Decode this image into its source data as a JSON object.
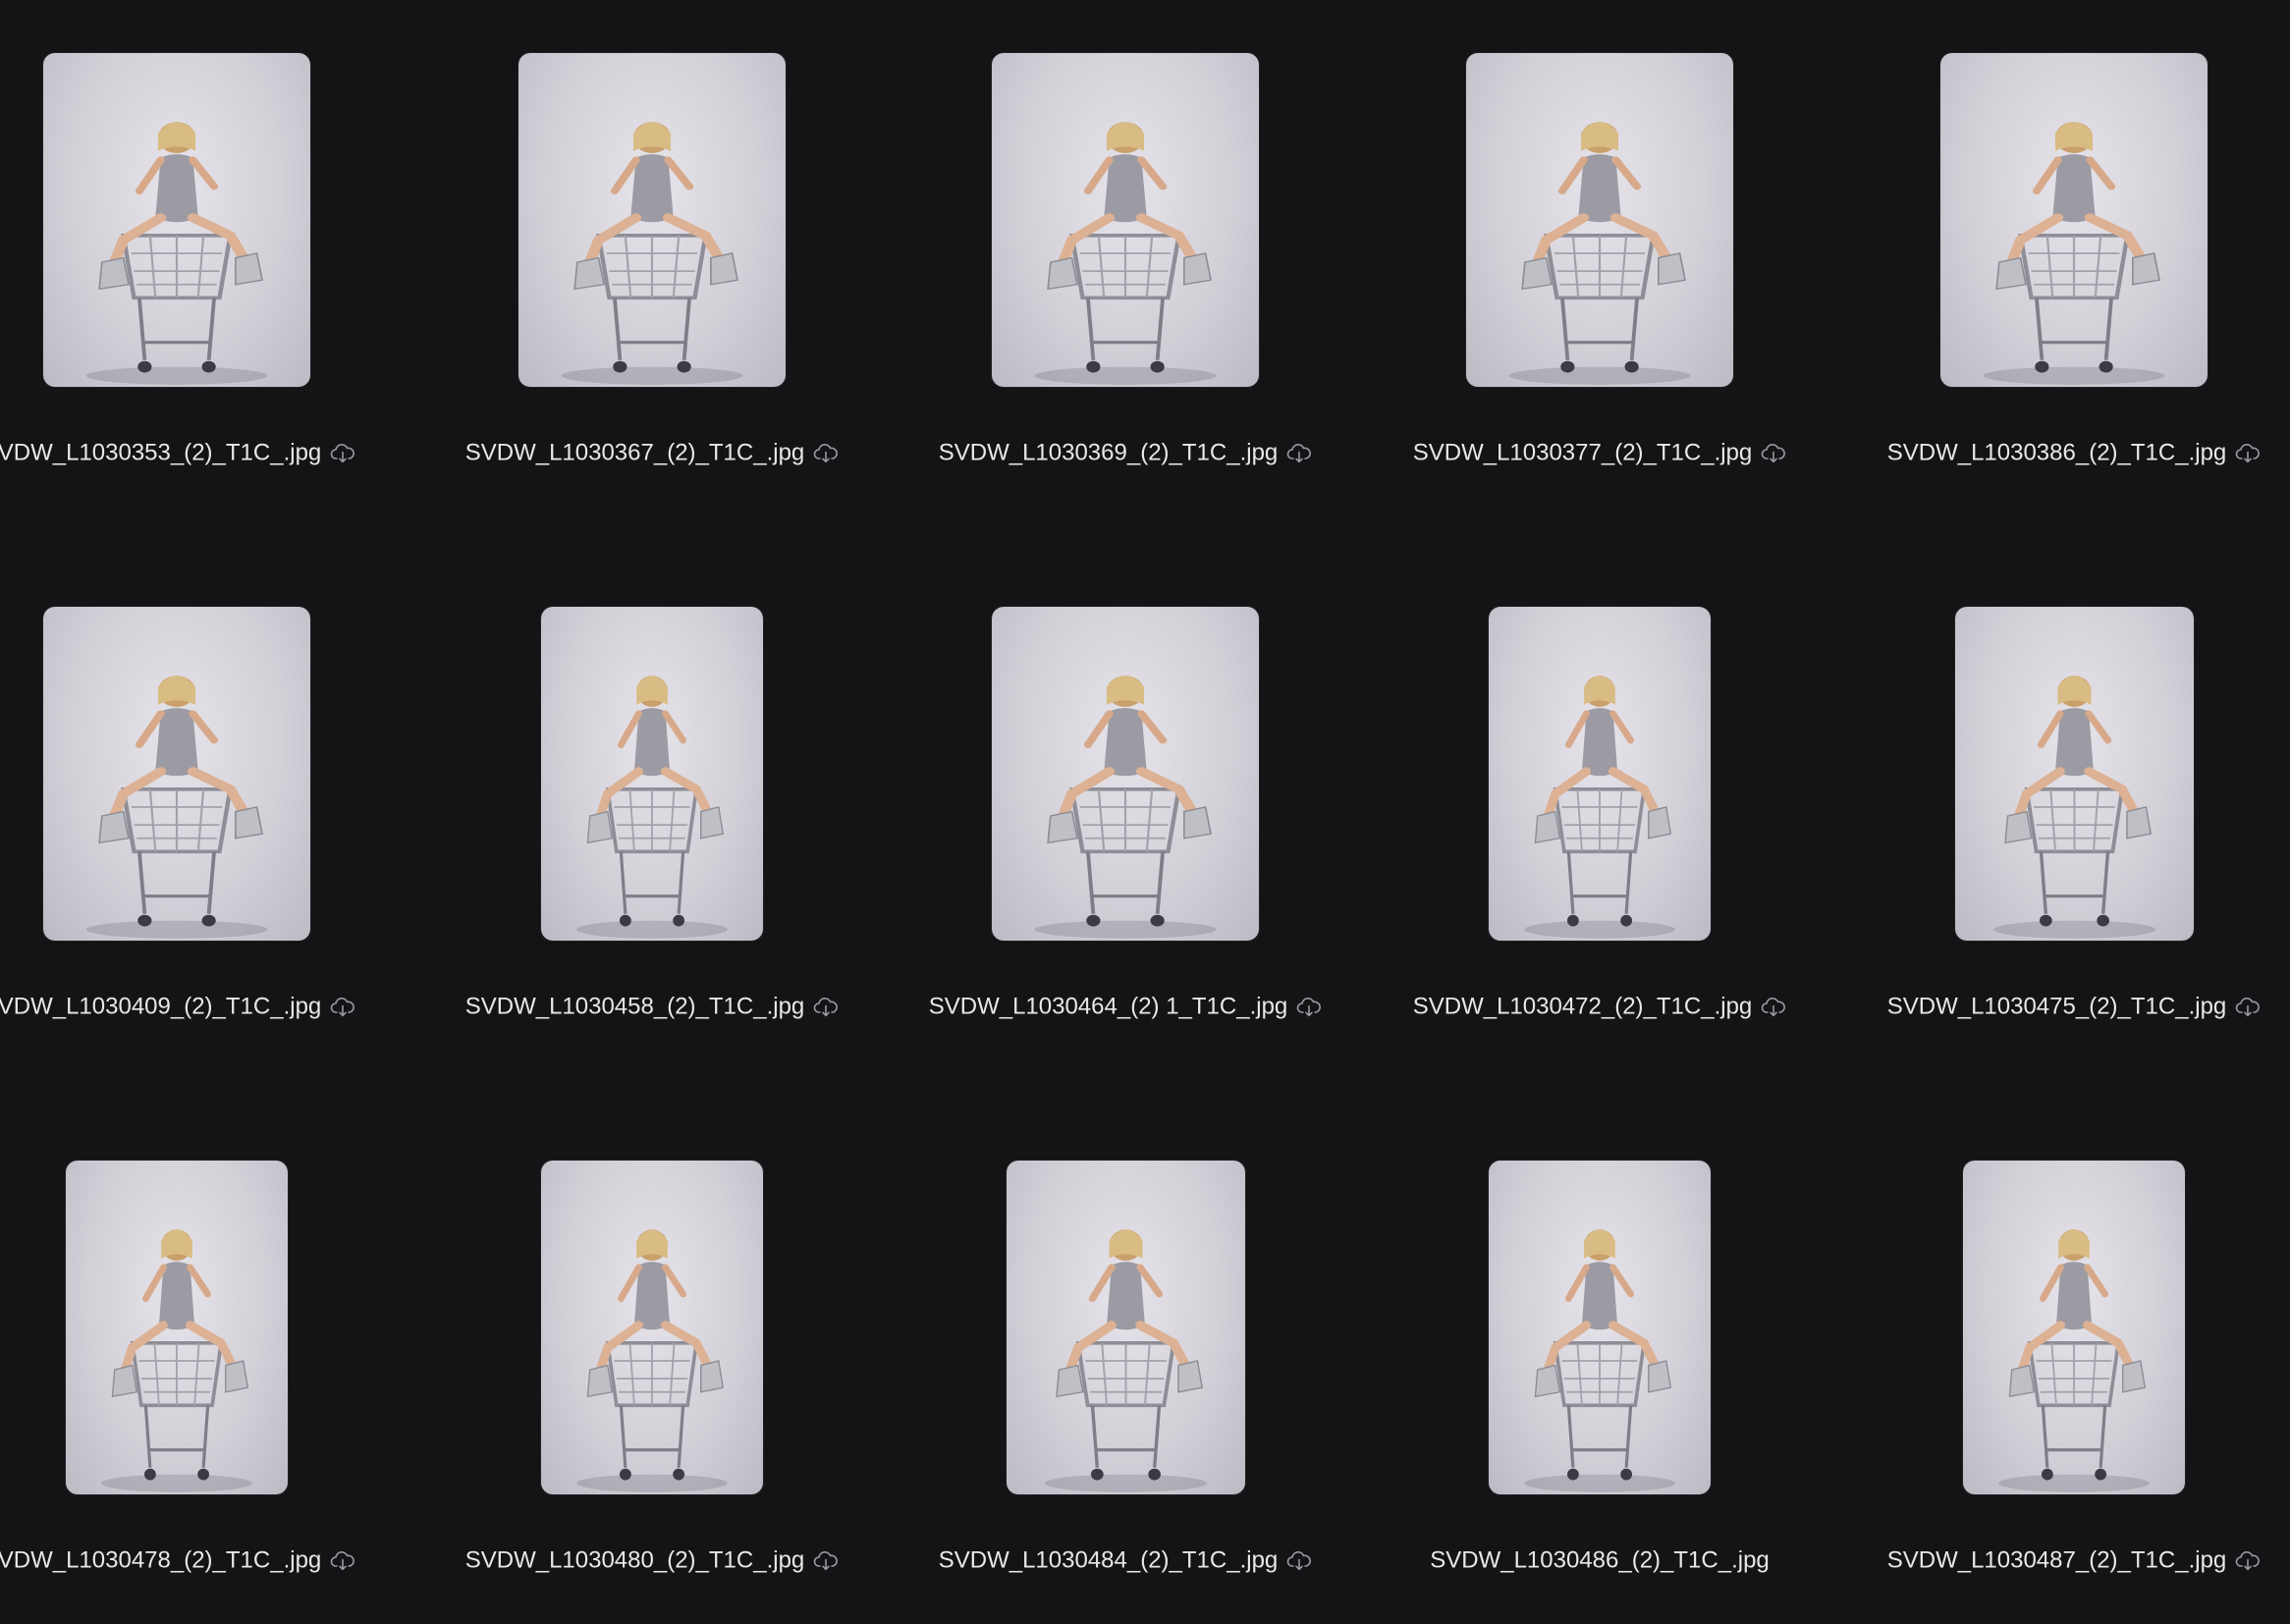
{
  "files": [
    {
      "name": "VDW_L1030353_(2)_T1C_.jpg",
      "cloud": true,
      "thumb": "landscape-wide"
    },
    {
      "name": "SVDW_L1030367_(2)_T1C_.jpg",
      "cloud": true,
      "thumb": "landscape-wide"
    },
    {
      "name": "SVDW_L1030369_(2)_T1C_.jpg",
      "cloud": true,
      "thumb": "landscape-wide"
    },
    {
      "name": "SVDW_L1030377_(2)_T1C_.jpg",
      "cloud": true,
      "thumb": "landscape-wide"
    },
    {
      "name": "SVDW_L1030386_(2)_T1C_.jpg",
      "cloud": true,
      "thumb": "landscape-wide"
    },
    {
      "name": "VDW_L1030409_(2)_T1C_.jpg",
      "cloud": true,
      "thumb": "landscape-wide"
    },
    {
      "name": "SVDW_L1030458_(2)_T1C_.jpg",
      "cloud": true,
      "thumb": "portrait-narrow"
    },
    {
      "name": "SVDW_L1030464_(2) 1_T1C_.jpg",
      "cloud": true,
      "thumb": "landscape-wide"
    },
    {
      "name": "SVDW_L1030472_(2)_T1C_.jpg",
      "cloud": true,
      "thumb": "portrait-narrow"
    },
    {
      "name": "SVDW_L1030475_(2)_T1C_.jpg",
      "cloud": true,
      "thumb": "portrait-medium"
    },
    {
      "name": "VDW_L1030478_(2)_T1C_.jpg",
      "cloud": true,
      "thumb": "portrait-narrow"
    },
    {
      "name": "SVDW_L1030480_(2)_T1C_.jpg",
      "cloud": true,
      "thumb": "portrait-narrow"
    },
    {
      "name": "SVDW_L1030484_(2)_T1C_.jpg",
      "cloud": true,
      "thumb": "portrait-medium"
    },
    {
      "name": "SVDW_L1030486_(2)_T1C_.jpg",
      "cloud": false,
      "thumb": "portrait-narrow"
    },
    {
      "name": "SVDW_L1030487_(2)_T1C_.jpg",
      "cloud": true,
      "thumb": "portrait-narrow"
    }
  ],
  "icons": {
    "cloud": "cloud-download-icon"
  },
  "colors": {
    "background": "#141416",
    "text": "#e8e8ea",
    "thumb_backdrop": "#d3d0d8",
    "cloud_icon": "#9a9aa0"
  }
}
